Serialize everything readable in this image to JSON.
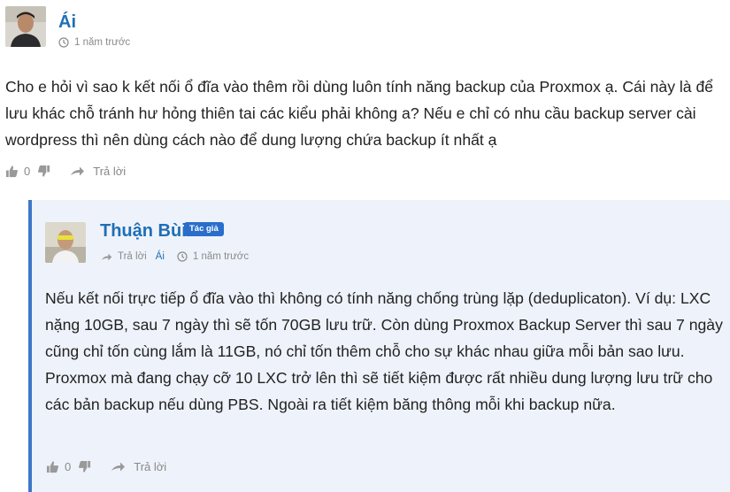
{
  "comment": {
    "author": "Ái",
    "time": "1 năm trước",
    "text": "Cho e hỏi vì sao k kết nối ổ đĩa vào thêm rồi dùng luôn tính năng backup của Proxmox ạ. Cái này là để lưu khác chỗ tránh hư hỏng thiên tai các kiểu phải không a? Nếu e chỉ có nhu cầu backup server cài wordpress thì nên dùng cách nào để dung lượng chứa backup ít nhất ạ",
    "likes": "0",
    "reply_label": "Trả lời"
  },
  "reply": {
    "author": "Thuận Bùi",
    "badge": "Tác giả",
    "reply_to_label": "Trả lời",
    "reply_to_user": "Ái",
    "time": "1 năm trước",
    "text": "Nếu kết nối trực tiếp ổ đĩa vào thì không có tính năng chống trùng lặp (deduplicaton). Ví dụ: LXC nặng 10GB, sau 7 ngày thì sẽ tốn 70GB lưu trữ. Còn dùng Proxmox Backup Server thì sau 7 ngày cũng chỉ tốn cùng lắm là 11GB, nó chỉ tốn thêm chỗ cho sự khác nhau giữa mỗi bản sao lưu. Proxmox mà đang chạy cỡ 10 LXC trở lên thì sẽ tiết kiệm được rất nhiều dung lượng lưu trữ cho các bản backup nếu dùng PBS. Ngoài ra tiết kiệm băng thông mỗi khi backup nữa.",
    "likes": "0",
    "reply_label": "Trả lời"
  },
  "colors": {
    "author": "#1f6fb5",
    "badge": "#2a6ecb",
    "reply_border": "#3f77c9",
    "reply_bg": "#eef3fb"
  }
}
